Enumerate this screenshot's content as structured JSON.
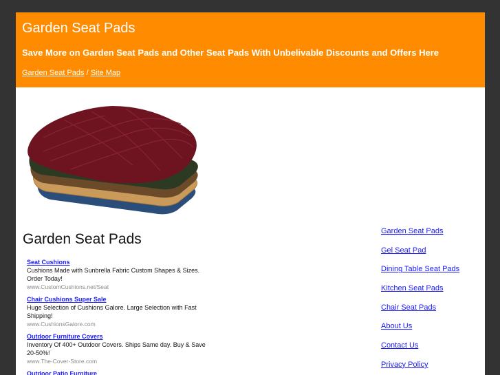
{
  "header": {
    "title": "Garden Seat Pads",
    "tagline": "Save More on Garden Seat Pads and Other Seat Pads With Unbelivable Discounts and Offers Here",
    "breadcrumb": {
      "link1": "Garden Seat Pads",
      "separator": " / ",
      "link2": "Site Map"
    }
  },
  "main": {
    "heading": "Garden Seat Pads",
    "ads": [
      {
        "title": "Seat Cushions",
        "text": "Cushions Made with Sunbrella Fabric Custom Shapes & Sizes. Order Today!",
        "url": "www.CustomCushions.net/Seat"
      },
      {
        "title": "Chair Cushions Super Sale",
        "text": "Huge Selection of Cushions Galore. Large Selection with Fast Shipping!",
        "url": "www.CushionsGalore.com"
      },
      {
        "title": "Outdoor Furniture Covers",
        "text": "Inventory Of 400+ Outdoor Covers. Ships Same day. Buy & Save 20-50%!",
        "url": "www.The-Cover-Store.com"
      },
      {
        "title": "Outdoor Patio Furniture",
        "text": "",
        "url": ""
      }
    ]
  },
  "sidebar": {
    "links": [
      "Garden Seat Pads",
      "Gel Seat Pad",
      "Dining Table Seat Pads",
      "Kitchen Seat Pads",
      "Chair Seat Pads",
      "About Us",
      "Contact Us",
      "Privacy Policy"
    ]
  },
  "colors": {
    "page_bg": "#333333",
    "header_bg": "#ff8c00",
    "link": "#1a1aff"
  }
}
